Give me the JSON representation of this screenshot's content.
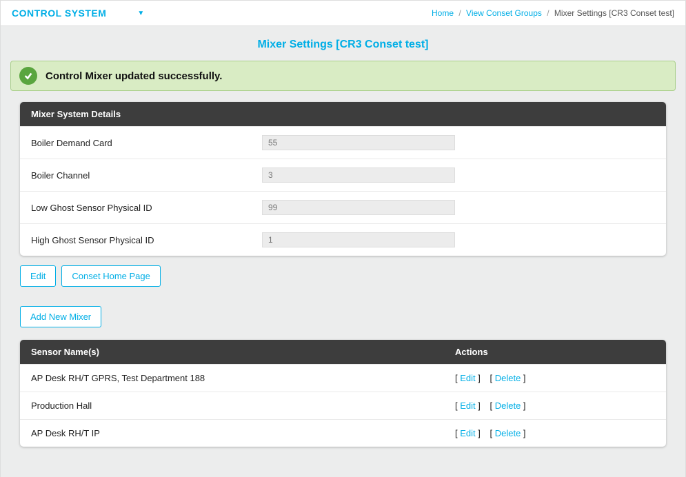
{
  "header": {
    "system_label": "CONTROL SYSTEM",
    "breadcrumb": {
      "home": "Home",
      "groups": "View Conset Groups",
      "current": "Mixer Settings [CR3 Conset test]"
    }
  },
  "page_title": "Mixer Settings [CR3 Conset test]",
  "alert": {
    "message": "Control Mixer updated successfully."
  },
  "details_card": {
    "title": "Mixer System Details",
    "fields": [
      {
        "label": "Boiler Demand Card",
        "value": "55"
      },
      {
        "label": "Boiler Channel",
        "value": "3"
      },
      {
        "label": "Low Ghost Sensor Physical ID",
        "value": "99"
      },
      {
        "label": "High Ghost Sensor Physical ID",
        "value": "1"
      }
    ]
  },
  "buttons": {
    "edit": "Edit",
    "conset_home": "Conset Home Page",
    "add_mixer": "Add New Mixer"
  },
  "sensor_table": {
    "headers": {
      "name": "Sensor Name(s)",
      "actions": "Actions"
    },
    "action_labels": {
      "edit": "Edit",
      "delete": "Delete"
    },
    "rows": [
      {
        "name": "AP Desk RH/T GPRS, Test Department 188"
      },
      {
        "name": "Production Hall"
      },
      {
        "name": "AP Desk RH/T IP"
      }
    ]
  }
}
